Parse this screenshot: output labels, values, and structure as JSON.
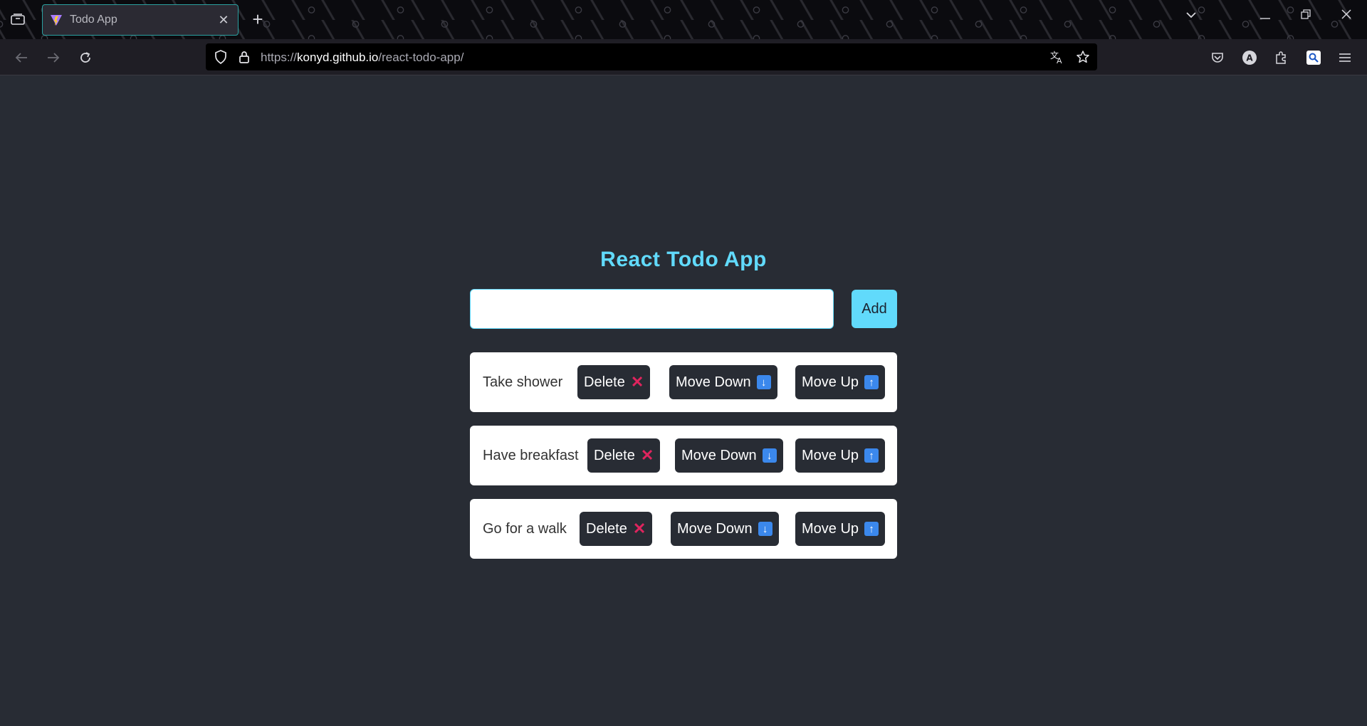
{
  "browser": {
    "tab_title": "Todo App",
    "new_tab_label": "+",
    "url_scheme": "https://",
    "url_host": "konyd.github.io",
    "url_path": "/react-todo-app/"
  },
  "app": {
    "title": "React Todo App",
    "input_value": "",
    "add_label": "Add",
    "accent_color": "#61dafb",
    "background_color": "#282c34"
  },
  "todos": [
    {
      "text": "Take shower",
      "delete_label": "Delete",
      "move_down_label": "Move Down",
      "move_up_label": "Move Up"
    },
    {
      "text": "Have breakfast",
      "delete_label": "Delete",
      "move_down_label": "Move Down",
      "move_up_label": "Move Up"
    },
    {
      "text": "Go for a walk",
      "delete_label": "Delete",
      "move_down_label": "Move Down",
      "move_up_label": "Move Up"
    }
  ],
  "icons": {
    "delete": "cross-mark-icon",
    "move_down": "down-arrow-icon",
    "move_up": "up-arrow-icon"
  }
}
